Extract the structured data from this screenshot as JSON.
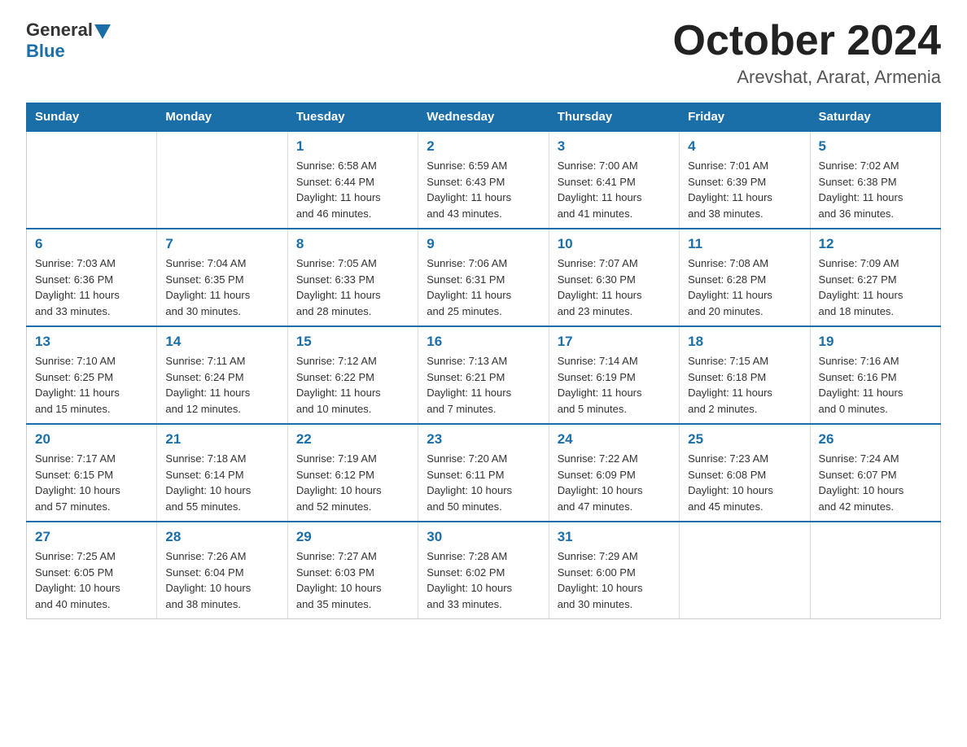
{
  "header": {
    "logo_general": "General",
    "logo_blue": "Blue",
    "title": "October 2024",
    "location": "Arevshat, Ararat, Armenia"
  },
  "calendar": {
    "days_of_week": [
      "Sunday",
      "Monday",
      "Tuesday",
      "Wednesday",
      "Thursday",
      "Friday",
      "Saturday"
    ],
    "weeks": [
      [
        {
          "day": "",
          "info": ""
        },
        {
          "day": "",
          "info": ""
        },
        {
          "day": "1",
          "info": "Sunrise: 6:58 AM\nSunset: 6:44 PM\nDaylight: 11 hours\nand 46 minutes."
        },
        {
          "day": "2",
          "info": "Sunrise: 6:59 AM\nSunset: 6:43 PM\nDaylight: 11 hours\nand 43 minutes."
        },
        {
          "day": "3",
          "info": "Sunrise: 7:00 AM\nSunset: 6:41 PM\nDaylight: 11 hours\nand 41 minutes."
        },
        {
          "day": "4",
          "info": "Sunrise: 7:01 AM\nSunset: 6:39 PM\nDaylight: 11 hours\nand 38 minutes."
        },
        {
          "day": "5",
          "info": "Sunrise: 7:02 AM\nSunset: 6:38 PM\nDaylight: 11 hours\nand 36 minutes."
        }
      ],
      [
        {
          "day": "6",
          "info": "Sunrise: 7:03 AM\nSunset: 6:36 PM\nDaylight: 11 hours\nand 33 minutes."
        },
        {
          "day": "7",
          "info": "Sunrise: 7:04 AM\nSunset: 6:35 PM\nDaylight: 11 hours\nand 30 minutes."
        },
        {
          "day": "8",
          "info": "Sunrise: 7:05 AM\nSunset: 6:33 PM\nDaylight: 11 hours\nand 28 minutes."
        },
        {
          "day": "9",
          "info": "Sunrise: 7:06 AM\nSunset: 6:31 PM\nDaylight: 11 hours\nand 25 minutes."
        },
        {
          "day": "10",
          "info": "Sunrise: 7:07 AM\nSunset: 6:30 PM\nDaylight: 11 hours\nand 23 minutes."
        },
        {
          "day": "11",
          "info": "Sunrise: 7:08 AM\nSunset: 6:28 PM\nDaylight: 11 hours\nand 20 minutes."
        },
        {
          "day": "12",
          "info": "Sunrise: 7:09 AM\nSunset: 6:27 PM\nDaylight: 11 hours\nand 18 minutes."
        }
      ],
      [
        {
          "day": "13",
          "info": "Sunrise: 7:10 AM\nSunset: 6:25 PM\nDaylight: 11 hours\nand 15 minutes."
        },
        {
          "day": "14",
          "info": "Sunrise: 7:11 AM\nSunset: 6:24 PM\nDaylight: 11 hours\nand 12 minutes."
        },
        {
          "day": "15",
          "info": "Sunrise: 7:12 AM\nSunset: 6:22 PM\nDaylight: 11 hours\nand 10 minutes."
        },
        {
          "day": "16",
          "info": "Sunrise: 7:13 AM\nSunset: 6:21 PM\nDaylight: 11 hours\nand 7 minutes."
        },
        {
          "day": "17",
          "info": "Sunrise: 7:14 AM\nSunset: 6:19 PM\nDaylight: 11 hours\nand 5 minutes."
        },
        {
          "day": "18",
          "info": "Sunrise: 7:15 AM\nSunset: 6:18 PM\nDaylight: 11 hours\nand 2 minutes."
        },
        {
          "day": "19",
          "info": "Sunrise: 7:16 AM\nSunset: 6:16 PM\nDaylight: 11 hours\nand 0 minutes."
        }
      ],
      [
        {
          "day": "20",
          "info": "Sunrise: 7:17 AM\nSunset: 6:15 PM\nDaylight: 10 hours\nand 57 minutes."
        },
        {
          "day": "21",
          "info": "Sunrise: 7:18 AM\nSunset: 6:14 PM\nDaylight: 10 hours\nand 55 minutes."
        },
        {
          "day": "22",
          "info": "Sunrise: 7:19 AM\nSunset: 6:12 PM\nDaylight: 10 hours\nand 52 minutes."
        },
        {
          "day": "23",
          "info": "Sunrise: 7:20 AM\nSunset: 6:11 PM\nDaylight: 10 hours\nand 50 minutes."
        },
        {
          "day": "24",
          "info": "Sunrise: 7:22 AM\nSunset: 6:09 PM\nDaylight: 10 hours\nand 47 minutes."
        },
        {
          "day": "25",
          "info": "Sunrise: 7:23 AM\nSunset: 6:08 PM\nDaylight: 10 hours\nand 45 minutes."
        },
        {
          "day": "26",
          "info": "Sunrise: 7:24 AM\nSunset: 6:07 PM\nDaylight: 10 hours\nand 42 minutes."
        }
      ],
      [
        {
          "day": "27",
          "info": "Sunrise: 7:25 AM\nSunset: 6:05 PM\nDaylight: 10 hours\nand 40 minutes."
        },
        {
          "day": "28",
          "info": "Sunrise: 7:26 AM\nSunset: 6:04 PM\nDaylight: 10 hours\nand 38 minutes."
        },
        {
          "day": "29",
          "info": "Sunrise: 7:27 AM\nSunset: 6:03 PM\nDaylight: 10 hours\nand 35 minutes."
        },
        {
          "day": "30",
          "info": "Sunrise: 7:28 AM\nSunset: 6:02 PM\nDaylight: 10 hours\nand 33 minutes."
        },
        {
          "day": "31",
          "info": "Sunrise: 7:29 AM\nSunset: 6:00 PM\nDaylight: 10 hours\nand 30 minutes."
        },
        {
          "day": "",
          "info": ""
        },
        {
          "day": "",
          "info": ""
        }
      ]
    ]
  }
}
